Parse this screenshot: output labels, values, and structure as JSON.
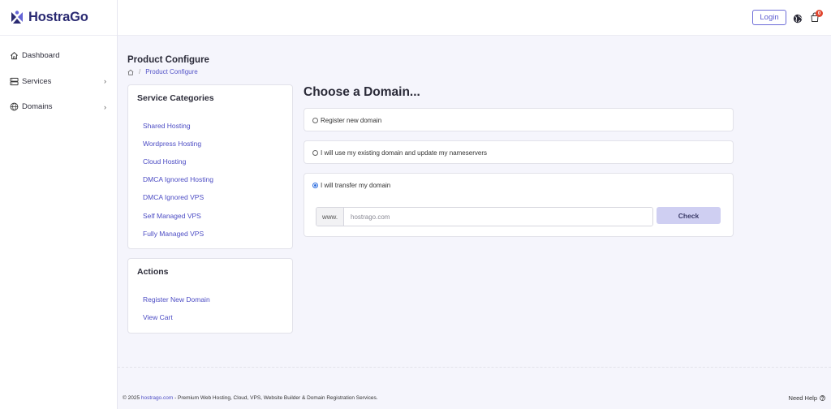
{
  "app": {
    "name": "HostraGo",
    "brand_color": "#2a2a72",
    "accent_color": "#5a5ad0"
  },
  "sidebar": {
    "items": [
      {
        "label": "Dashboard",
        "icon": "home-icon"
      },
      {
        "label": "Services",
        "icon": "server-icon",
        "has_submenu": true
      },
      {
        "label": "Domains",
        "icon": "globe-icon",
        "has_submenu": true
      }
    ]
  },
  "header": {
    "login_label": "Login",
    "cart_count": "0"
  },
  "page": {
    "title": "Product Configure",
    "breadcrumb": "Product Configure"
  },
  "categories": {
    "title": "Service Categories",
    "items": [
      "Shared Hosting",
      "Wordpress Hosting",
      "Cloud Hosting",
      "DMCA Ignored Hosting",
      "DMCA Ignored VPS",
      "Self Managed VPS",
      "Fully Managed VPS"
    ]
  },
  "actions": {
    "title": "Actions",
    "items": [
      "Register New Domain",
      "View Cart"
    ]
  },
  "domain": {
    "title": "Choose a Domain...",
    "options": [
      {
        "label": "Register new domain",
        "checked": false
      },
      {
        "label": "I will use my existing domain and update my nameservers",
        "checked": false
      },
      {
        "label": "I will transfer my domain",
        "checked": true
      }
    ],
    "prefix": "www.",
    "placeholder": "hostrago.com",
    "check_label": "Check"
  },
  "footer": {
    "copyright": "© 2025 ",
    "site_link": "hostrago.com",
    "tagline": " - Premium Web Hosting, Cloud, VPS, Website Builder & Domain Registration Services.",
    "help_label": "Need Help"
  }
}
